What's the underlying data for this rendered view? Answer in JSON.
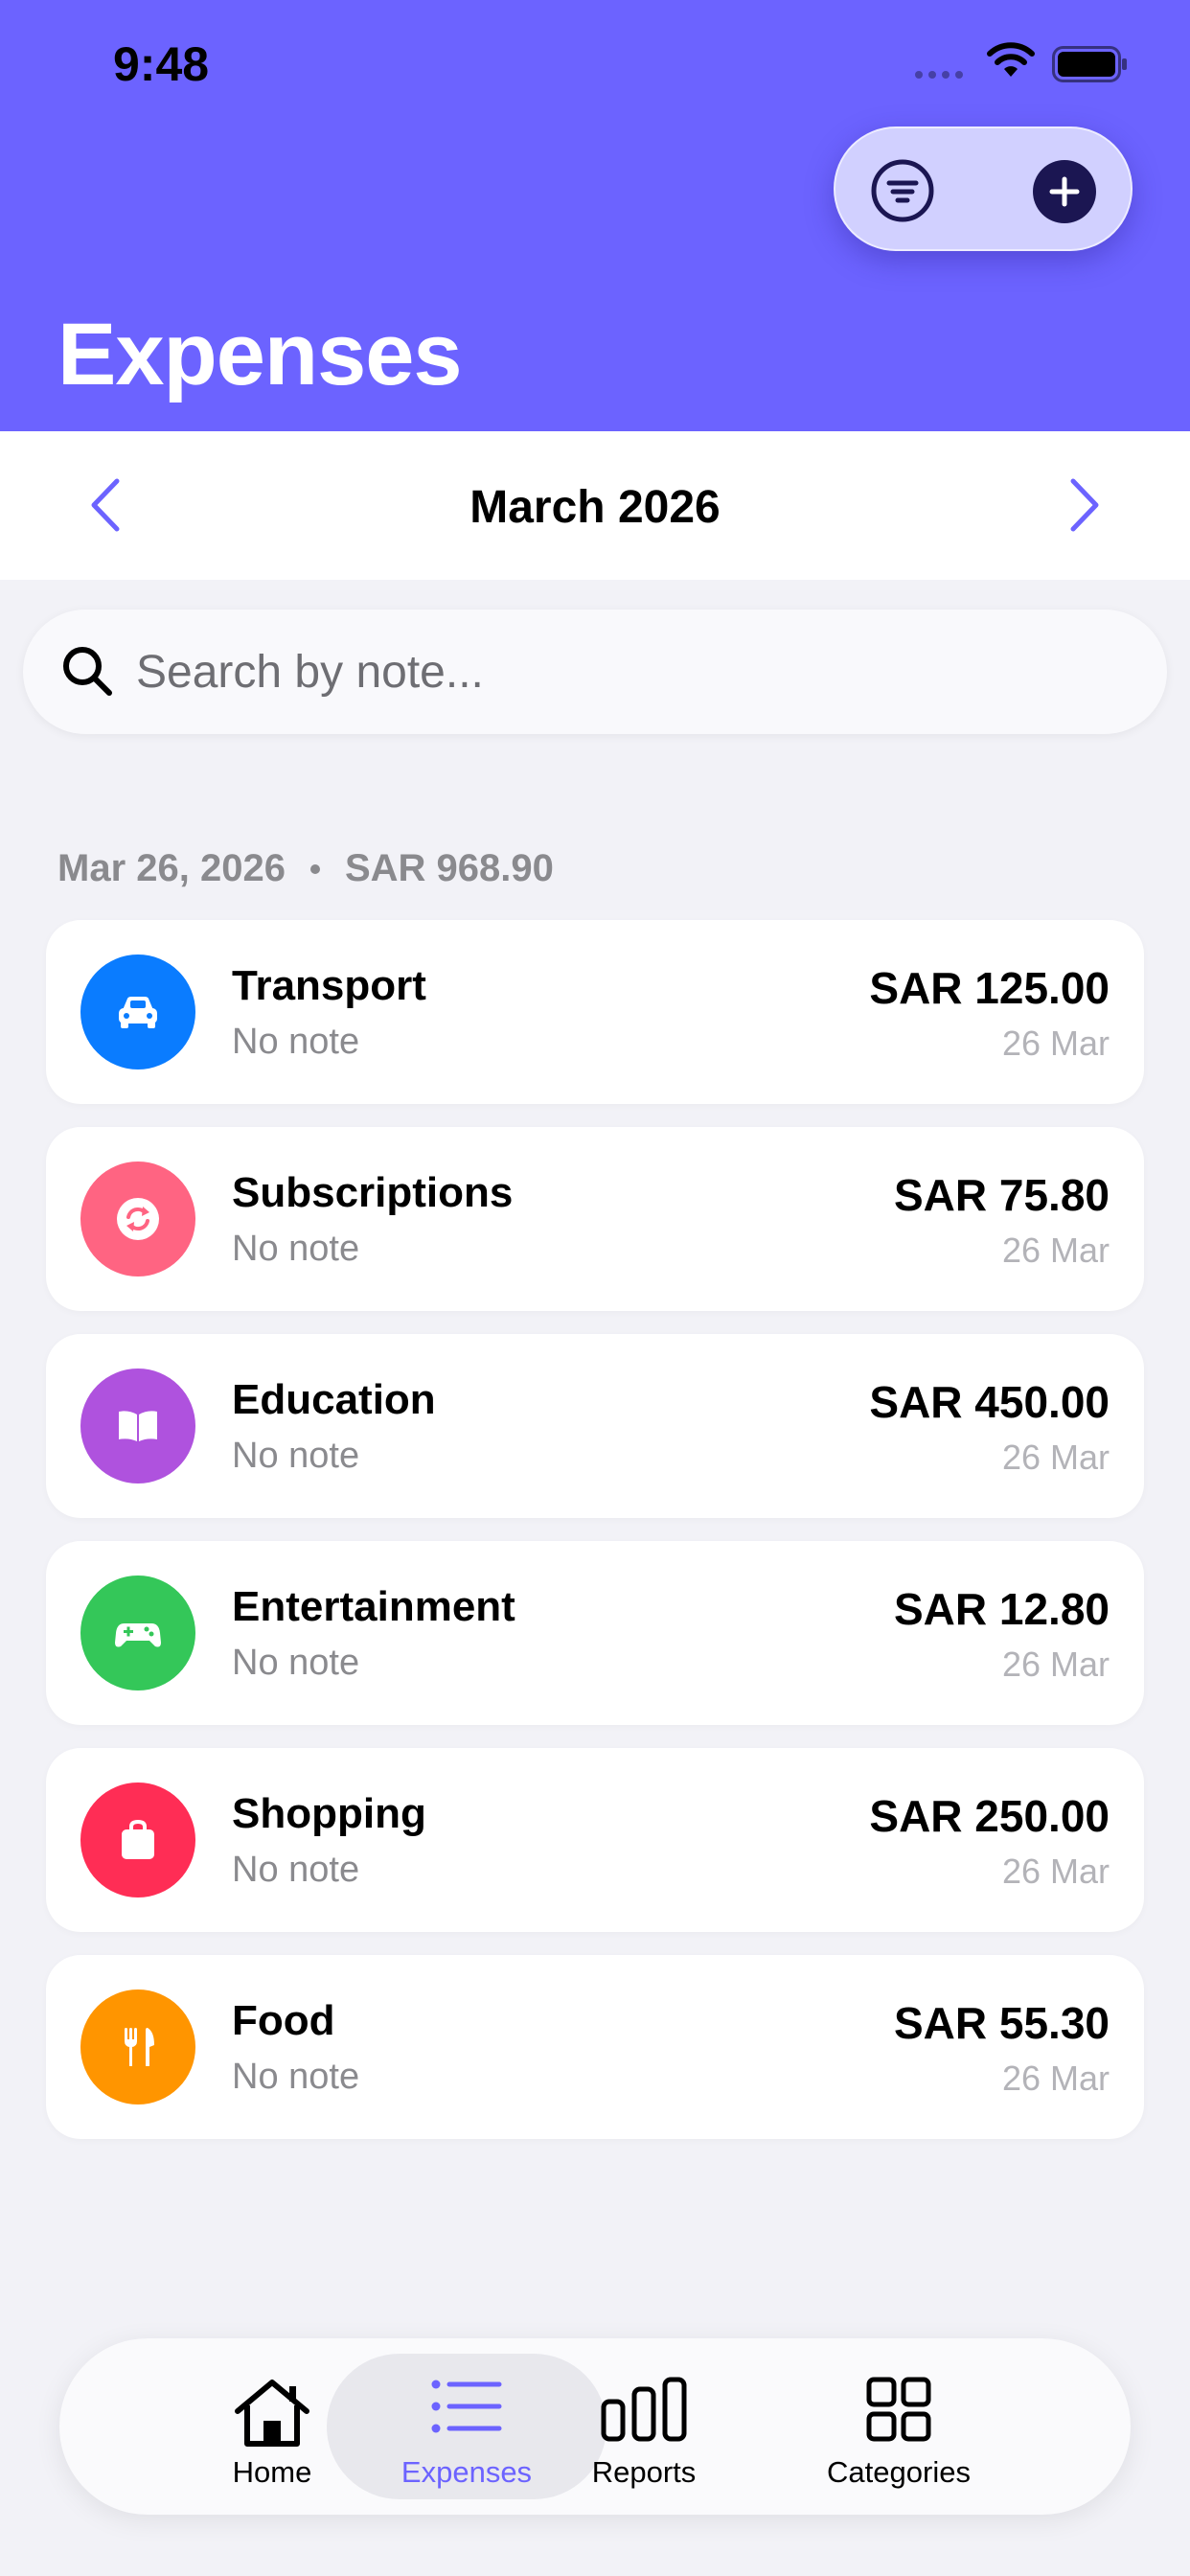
{
  "status": {
    "time": "9:48"
  },
  "header": {
    "title": "Expenses"
  },
  "month": {
    "label": "March 2026"
  },
  "search": {
    "placeholder": "Search by note..."
  },
  "section": {
    "date": "Mar 26, 2026",
    "total": "SAR 968.90"
  },
  "expenses": [
    {
      "category": "Transport",
      "note": "No note",
      "amount": "SAR 125.00",
      "date": "26 Mar",
      "color": "#0a7cff",
      "icon": "car-icon"
    },
    {
      "category": "Subscriptions",
      "note": "No note",
      "amount": "SAR 75.80",
      "date": "26 Mar",
      "color": "#ff6482",
      "icon": "repeat-icon"
    },
    {
      "category": "Education",
      "note": "No note",
      "amount": "SAR 450.00",
      "date": "26 Mar",
      "color": "#af52de",
      "icon": "book-icon"
    },
    {
      "category": "Entertainment",
      "note": "No note",
      "amount": "SAR 12.80",
      "date": "26 Mar",
      "color": "#34c759",
      "icon": "gamepad-icon"
    },
    {
      "category": "Shopping",
      "note": "No note",
      "amount": "SAR 250.00",
      "date": "26 Mar",
      "color": "#ff2d55",
      "icon": "bag-icon"
    },
    {
      "category": "Food",
      "note": "No note",
      "amount": "SAR 55.30",
      "date": "26 Mar",
      "color": "#ff9500",
      "icon": "fork-knife-icon"
    }
  ],
  "tabs": [
    {
      "label": "Home",
      "icon": "house-icon"
    },
    {
      "label": "Expenses",
      "icon": "list-icon"
    },
    {
      "label": "Reports",
      "icon": "bar-chart-icon"
    },
    {
      "label": "Categories",
      "icon": "grid-icon"
    }
  ],
  "colors": {
    "accent": "#6c63ff",
    "header_bg": "#6c63ff",
    "dark_button": "#1b1652"
  }
}
